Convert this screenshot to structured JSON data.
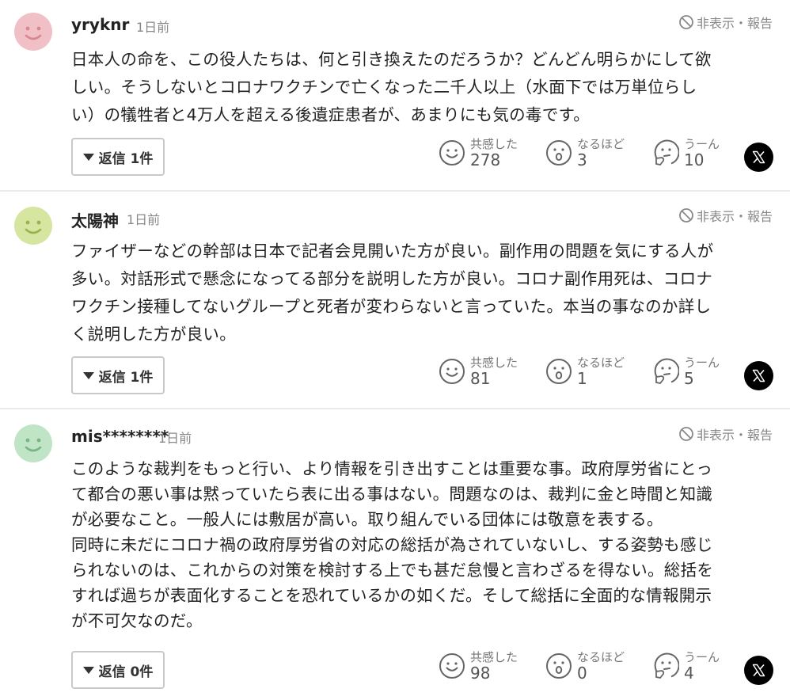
{
  "hide_report_label": "非表示・報告",
  "reactions_labels": {
    "agree": "共感した",
    "insight": "なるほど",
    "hmm": "うーん"
  },
  "icons": {
    "hide": "no-entry-icon",
    "agree": "smile-icon",
    "insight": "surprised-icon",
    "hmm": "thinking-icon",
    "share": "x-logo-icon",
    "reply": "triangle-down-icon"
  },
  "colors": {
    "avatar_1": "#f0c0c6",
    "avatar_2": "#d6e6a1",
    "avatar_3": "#bfe4c6",
    "text": "#222222",
    "muted": "#888888"
  },
  "comments": [
    {
      "username": "yryknr",
      "time": "1日前",
      "lines": [
        "日本人の命を、この役人たちは、何と引き換えたのだろうか？どんどん明らかにして欲",
        "しい。そうしないとコロナワクチンで亡くなった二千人以上（水面下では万単位らし",
        "い）の犠牲者と4万人を超える後遺症患者が、あまりにも気の毒です。"
      ],
      "reply_label": "返信 1件",
      "agree": "278",
      "insight": "3",
      "hmm": "10"
    },
    {
      "username": "太陽神",
      "time": "1日前",
      "lines": [
        "ファイザーなどの幹部は日本で記者会見開いた方が良い。副作用の問題を気にする人が",
        "多い。対話形式で懸念になってる部分を説明した方が良い。コロナ副作用死は、コロナ",
        "ワクチン接種してないグループと死者が変わらないと言っていた。本当の事なのか詳し",
        "く説明した方が良い。"
      ],
      "reply_label": "返信 1件",
      "agree": "81",
      "insight": "1",
      "hmm": "5"
    },
    {
      "username": "mis********",
      "time": "1日前",
      "lines": [
        "このような裁判をもっと行い、より情報を引き出すことは重要な事。政府厚労省にとっ",
        "て都合の悪い事は黙っていたら表に出る事はない。問題なのは、裁判に金と時間と知識",
        "が必要なこと。一般人には敷居が高い。取り組んでいる団体には敬意を表する。",
        "同時に未だにコロナ禍の政府厚労省の対応の総括が為されていないし、する姿勢も感じ",
        "られないのは、これからの対策を検討する上でも甚だ怠慢と言わざるを得ない。総括を",
        "すれば過ちが表面化することを恐れているかの如くだ。そして総括に全面的な情報開示",
        "が不可欠なのだ。"
      ],
      "reply_label": "返信 0件",
      "agree": "98",
      "insight": "0",
      "hmm": "4"
    }
  ]
}
